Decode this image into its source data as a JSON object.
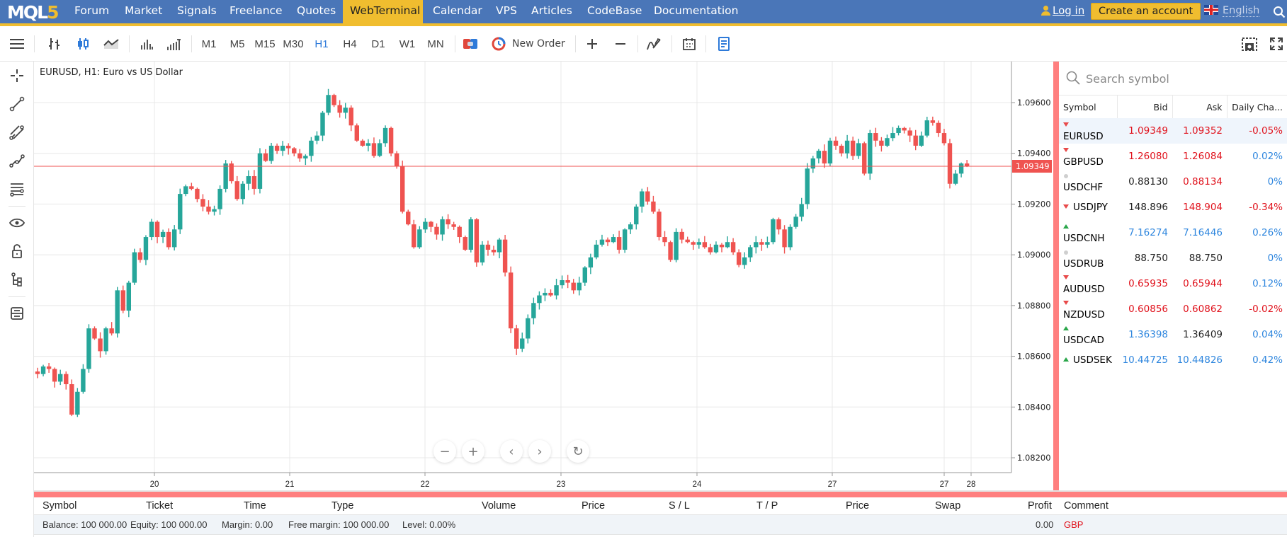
{
  "nav": {
    "logo_main": "MQL",
    "logo_num": "5",
    "items": [
      "Forum",
      "Market",
      "Signals",
      "Freelance",
      "Quotes",
      "WebTerminal",
      "Calendar",
      "VPS",
      "Articles",
      "CodeBase",
      "Documentation"
    ],
    "active": "WebTerminal",
    "login": "Log in",
    "create_account": "Create an account",
    "language": "English"
  },
  "toolbar": {
    "timeframes": [
      "M1",
      "M5",
      "M15",
      "M30",
      "H1",
      "H4",
      "D1",
      "W1",
      "MN"
    ],
    "active_timeframe": "H1",
    "new_order": "New Order",
    "icons": [
      "menu-icon",
      "bar-chart-icon",
      "candlestick-icon",
      "line-chart-icon",
      "volume-icon",
      "tick-volume-icon",
      "one-click-trading-icon",
      "new-order-icon",
      "zoom-in-icon",
      "zoom-out-icon",
      "indicators-icon",
      "calendar-icon",
      "notes-icon",
      "screenshot-icon",
      "fullscreen-icon"
    ]
  },
  "left_tools": [
    "crosshair-icon",
    "trendline-icon",
    "channel-icon",
    "polyline-icon",
    "fibonacci-icon",
    "eye-icon",
    "lock-icon",
    "object-tree-icon",
    "panels-icon"
  ],
  "chart": {
    "title": "EURUSD, H1: Euro vs US Dollar",
    "current_price_label": "1.09349",
    "zoom_controls": [
      "−",
      "+",
      "‹",
      "›",
      "↻"
    ]
  },
  "chart_data": {
    "type": "candlestick",
    "title": "EURUSD, H1: Euro vs US Dollar",
    "symbol": "EURUSD",
    "timeframe": "H1",
    "ylim": [
      1.0815,
      1.0965
    ],
    "y_ticks": [
      "1.09600",
      "1.09400",
      "1.09200",
      "1.09000",
      "1.08800",
      "1.08600",
      "1.08400",
      "1.08200"
    ],
    "x_ticks": [
      "20",
      "21",
      "22",
      "23",
      "24",
      "27",
      "27",
      "28"
    ],
    "current_price": 1.09349,
    "grid": true,
    "colors": {
      "up": "#26a69a",
      "down": "#ef5350",
      "price_line": "#ef5350"
    },
    "closes": [
      1.0853,
      1.0856,
      1.0855,
      1.085,
      1.0853,
      1.0849,
      1.0837,
      1.0846,
      1.0855,
      1.0871,
      1.0867,
      1.0862,
      1.0871,
      1.0869,
      1.0886,
      1.0878,
      1.0889,
      1.0901,
      1.0898,
      1.0907,
      1.0913,
      1.0907,
      1.0909,
      1.0903,
      1.091,
      1.0924,
      1.0927,
      1.0926,
      1.0922,
      1.0919,
      1.0917,
      1.0918,
      1.0926,
      1.0936,
      1.0929,
      1.0922,
      1.0928,
      1.0931,
      1.0926,
      1.094,
      1.0937,
      1.0943,
      1.0941,
      1.0943,
      1.0942,
      1.094,
      1.0938,
      1.0939,
      1.0945,
      1.0947,
      1.0956,
      1.0963,
      1.0959,
      1.0956,
      1.0958,
      1.0951,
      1.0945,
      1.0943,
      1.0944,
      1.0939,
      1.0944,
      1.095,
      1.094,
      1.0935,
      1.0917,
      1.0912,
      1.0903,
      1.091,
      1.0913,
      1.0911,
      1.0908,
      1.0914,
      1.0912,
      1.0911,
      1.0907,
      1.0902,
      1.0914,
      1.0897,
      1.0904,
      1.0902,
      1.0901,
      1.0906,
      1.0893,
      1.0871,
      1.0863,
      1.0867,
      1.0875,
      1.0881,
      1.0884,
      1.0885,
      1.0884,
      1.0888,
      1.089,
      1.0889,
      1.0886,
      1.0889,
      1.0895,
      1.0899,
      1.0904,
      1.0906,
      1.0905,
      1.0907,
      1.0902,
      1.091,
      1.0912,
      1.0919,
      1.0925,
      1.0921,
      1.0917,
      1.0907,
      1.0905,
      1.0898,
      1.0909,
      1.0906,
      1.0905,
      1.0904,
      1.0905,
      1.0903,
      1.0901,
      1.0904,
      1.0903,
      1.0905,
      1.0901,
      1.0896,
      1.0899,
      1.0903,
      1.0905,
      1.0904,
      1.0905,
      1.0914,
      1.091,
      1.0903,
      1.0911,
      1.0915,
      1.092,
      1.0934,
      1.0938,
      1.0941,
      1.0936,
      1.0945,
      1.0943,
      1.094,
      1.0945,
      1.0939,
      1.0944,
      1.0932,
      1.0948,
      1.0945,
      1.0943,
      1.0946,
      1.0948,
      1.095,
      1.0949,
      1.0947,
      1.0943,
      1.0947,
      1.0953,
      1.0952,
      1.0948,
      1.0944,
      1.0928,
      1.0932,
      1.0936,
      1.0935
    ]
  },
  "market_watch": {
    "search_placeholder": "Search symbol",
    "columns": [
      "Symbol",
      "Bid",
      "Ask",
      "Daily Cha..."
    ],
    "rows": [
      {
        "symbol": "EURUSD",
        "dir": "down",
        "bid": "1.09349",
        "bid_c": "down",
        "ask": "1.09352",
        "ask_c": "down",
        "change": "-0.05%",
        "change_c": "down",
        "selected": true
      },
      {
        "symbol": "GBPUSD",
        "dir": "down",
        "bid": "1.26080",
        "bid_c": "down",
        "ask": "1.26084",
        "ask_c": "down",
        "change": "0.02%",
        "change_c": "up"
      },
      {
        "symbol": "USDCHF",
        "dir": "flat",
        "bid": "0.88130",
        "bid_c": "flat",
        "ask": "0.88134",
        "ask_c": "down",
        "change": "0%",
        "change_c": "up"
      },
      {
        "symbol": "USDJPY",
        "dir": "down",
        "bid": "148.896",
        "bid_c": "flat",
        "ask": "148.904",
        "ask_c": "down",
        "change": "-0.34%",
        "change_c": "down"
      },
      {
        "symbol": "USDCNH",
        "dir": "up",
        "bid": "7.16274",
        "bid_c": "up",
        "ask": "7.16446",
        "ask_c": "up",
        "change": "0.26%",
        "change_c": "up"
      },
      {
        "symbol": "USDRUB",
        "dir": "flat",
        "bid": "88.750",
        "bid_c": "flat",
        "ask": "88.750",
        "ask_c": "flat",
        "change": "0%",
        "change_c": "up"
      },
      {
        "symbol": "AUDUSD",
        "dir": "down",
        "bid": "0.65935",
        "bid_c": "down",
        "ask": "0.65944",
        "ask_c": "down",
        "change": "0.12%",
        "change_c": "up"
      },
      {
        "symbol": "NZDUSD",
        "dir": "down",
        "bid": "0.60856",
        "bid_c": "down",
        "ask": "0.60862",
        "ask_c": "down",
        "change": "-0.02%",
        "change_c": "down"
      },
      {
        "symbol": "USDCAD",
        "dir": "up",
        "bid": "1.36398",
        "bid_c": "up",
        "ask": "1.36409",
        "ask_c": "flat",
        "change": "0.04%",
        "change_c": "up"
      },
      {
        "symbol": "USDSEK",
        "dir": "up",
        "bid": "10.44725",
        "bid_c": "up",
        "ask": "10.44826",
        "ask_c": "up",
        "change": "0.42%",
        "change_c": "up"
      }
    ]
  },
  "trade": {
    "columns": [
      "Symbol",
      "Ticket",
      "Time",
      "Type",
      "Volume",
      "Price",
      "S / L",
      "T / P",
      "Price",
      "Swap",
      "Profit",
      "Comment"
    ],
    "balance": "Balance: 100 000.00",
    "equity": "Equity: 100 000.00",
    "margin": "Margin: 0.00",
    "free_margin": "Free margin: 100 000.00",
    "level": "Level: 0.00%",
    "profit": "0.00",
    "currency": "GBP"
  }
}
